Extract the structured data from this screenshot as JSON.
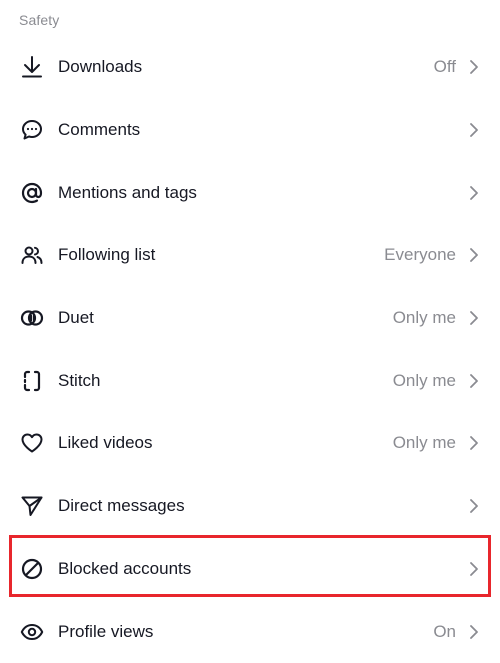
{
  "section_title": "Safety",
  "items": [
    {
      "label": "Downloads",
      "value": "Off",
      "icon": "download-icon"
    },
    {
      "label": "Comments",
      "value": "",
      "icon": "comment-icon"
    },
    {
      "label": "Mentions and tags",
      "value": "",
      "icon": "at-sign-icon"
    },
    {
      "label": "Following list",
      "value": "Everyone",
      "icon": "people-icon"
    },
    {
      "label": "Duet",
      "value": "Only me",
      "icon": "duet-icon"
    },
    {
      "label": "Stitch",
      "value": "Only me",
      "icon": "stitch-icon"
    },
    {
      "label": "Liked videos",
      "value": "Only me",
      "icon": "heart-icon"
    },
    {
      "label": "Direct messages",
      "value": "",
      "icon": "send-icon"
    },
    {
      "label": "Blocked accounts",
      "value": "",
      "icon": "block-icon",
      "highlighted": true
    },
    {
      "label": "Profile views",
      "value": "On",
      "icon": "eye-icon"
    }
  ],
  "colors": {
    "text": "#161823",
    "secondary_text": "#8a8b91",
    "highlight_border": "#e8262c",
    "background": "#ffffff"
  }
}
